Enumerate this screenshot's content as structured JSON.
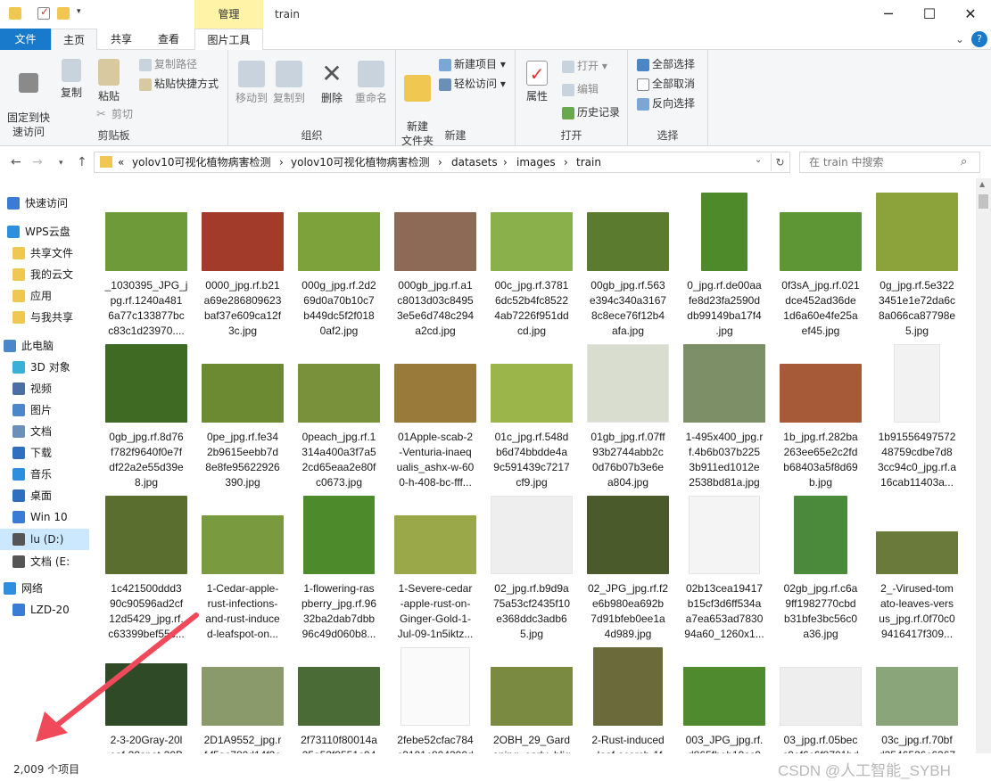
{
  "titlebar": {
    "manage_tab": "管理",
    "window_title": "train",
    "minimize": "─",
    "maximize": "☐",
    "close": "✕"
  },
  "tabs": {
    "file": "文件",
    "home": "主页",
    "share": "共享",
    "view": "查看",
    "picture_tools": "图片工具",
    "collapse": "⌄",
    "help": "?"
  },
  "ribbon": {
    "clipboard": {
      "label": "剪贴板",
      "pin": "固定到快\n速访问",
      "copy": "复制",
      "paste": "粘贴",
      "copy_path": "复制路径",
      "paste_shortcut": "粘贴快捷方式",
      "cut": "剪切"
    },
    "organize": {
      "label": "组织",
      "move_to": "移动到",
      "copy_to": "复制到",
      "delete": "删除",
      "rename": "重命名"
    },
    "new": {
      "label": "新建",
      "new_folder": "新建\n文件夹",
      "new_item": "新建项目 ▾",
      "easy_access": "轻松访问 ▾"
    },
    "open": {
      "label": "打开",
      "properties": "属性",
      "open": "打开 ▾",
      "edit": "编辑",
      "history": "历史记录"
    },
    "select": {
      "label": "选择",
      "select_all": "全部选择",
      "select_none": "全部取消",
      "invert": "反向选择"
    }
  },
  "address": {
    "crumbs": [
      "«",
      "yolov10可视化植物病害检测",
      "›",
      "yolov10可视化植物病害检测",
      "›",
      "datasets",
      "›",
      "images",
      "›",
      "train"
    ],
    "search_placeholder": "在 train 中搜索"
  },
  "navpane": {
    "items": [
      "快速访问",
      "WPS云盘",
      "共享文件",
      "我的云文",
      "应用",
      "与我共享",
      "此电脑",
      "3D 对象",
      "视频",
      "图片",
      "文档",
      "下载",
      "音乐",
      "桌面",
      "Win 10",
      "lu (D:)",
      "文档 (E:",
      "网络",
      "LZD-20"
    ]
  },
  "files": [
    {
      "name": "_1030395_JPG_j\npg.rf.1240a481\n6a77c133877bc\nc83c1d23970....",
      "color": "#6f9a3a"
    },
    {
      "name": "0000_jpg.rf.b21\na69e286809623\nbaf37e609ca12f\n3c.jpg",
      "color": "#a33b2a"
    },
    {
      "name": "000g_jpg.rf.2d2\n69d0a70b10c7\nb449dc5f2f018\n0af2.jpg",
      "color": "#7da23c"
    },
    {
      "name": "000gb_jpg.rf.a1\nc8013d03c8495\n3e5e6d748c294\na2cd.jpg",
      "color": "#8c6a55"
    },
    {
      "name": "00c_jpg.rf.3781\n6dc52b4fc8522\n4ab7226f951dd\ncd.jpg",
      "color": "#89b04a"
    },
    {
      "name": "00gb_jpg.rf.563\ne394c340a3167\n8c8ece76f12b4\nafa.jpg",
      "color": "#5b7b2e"
    },
    {
      "name": "0_jpg.rf.de00aa\nfe8d23fa2590d\ndb99149ba17f4\n.jpg",
      "color": "#4f8a2a"
    },
    {
      "name": "0f3sA_jpg.rf.021\ndce452ad36de\n1d6a60e4fe25a\nef45.jpg",
      "color": "#5e9636"
    },
    {
      "name": "0g_jpg.rf.5e322\n3451e1e72da6c\n8a066ca87798e\n5.jpg",
      "color": "#8ba33a"
    },
    {
      "name": "0gb_jpg.rf.8d76\nf782f9640f0e7f\ndf22a2e55d39e\n8.jpg",
      "color": "#3f6a24"
    },
    {
      "name": "0pe_jpg.rf.fe34\n2b9615eebb7d\n8e8fe95622926\n390.jpg",
      "color": "#6b8a32"
    },
    {
      "name": "0peach_jpg.rf.1\n314a400a3f7a5\n2cd65eaa2e80f\nc0673.jpg",
      "color": "#78913a"
    },
    {
      "name": "01Apple-scab-2\n-Venturia-inaeq\nualis_ashx-w-60\n0-h-408-bc-fff...",
      "color": "#9a7a3a"
    },
    {
      "name": "01c_jpg.rf.548d\nb6d74bbdde4a\n9c591439c7217\ncf9.jpg",
      "color": "#9cb54a"
    },
    {
      "name": "01gb_jpg.rf.07ff\n93b2744abb2c\n0d76b07b3e6e\na804.jpg",
      "color": "#d9ddd0"
    },
    {
      "name": "1-495x400_jpg.r\nf.4b6b037b225\n3b911ed1012e\n2538bd81a.jpg",
      "color": "#7d8f66"
    },
    {
      "name": "1b_jpg.rf.282ba\n263ee65e2c2fd\nb68403a5f8d69\nb.jpg",
      "color": "#a65a38"
    },
    {
      "name": "1b91556497572\n48759cdbe7d8\n3cc94c0_jpg.rf.a\n16cab11403a...",
      "color": "#f2f2f2"
    },
    {
      "name": "1c421500ddd3\n90c90596ad2cf\n12d5429_jpg.rf.\nc63399bef55c...",
      "color": "#5a6e30"
    },
    {
      "name": "1-Cedar-apple-\nrust-infections-\nand-rust-induce\nd-leafspot-on...",
      "color": "#7a9a40"
    },
    {
      "name": "1-flowering-ras\npberry_jpg.rf.96\n32ba2dab7dbb\n96c49d060b8...",
      "color": "#4c8a2c"
    },
    {
      "name": "1-Severe-cedar\n-apple-rust-on-\nGinger-Gold-1-\nJul-09-1n5iktz...",
      "color": "#9aa84a"
    },
    {
      "name": "02_jpg.rf.b9d9a\n75a53cf2435f10\ne368ddc3adb6\n5.jpg",
      "color": "#eeeeee"
    },
    {
      "name": "02_JPG_jpg.rf.f2\ne6b980ea692b\n7d91bfeb0ee1a\n4d989.jpg",
      "color": "#4a5a2a"
    },
    {
      "name": "02b13cea19417\nb15cf3d6ff534a\na7ea653ad7830\n94a60_1260x1...",
      "color": "#f4f4f4"
    },
    {
      "name": "02gb_jpg.rf.c6a\n9ff1982770cbd\nb31bfe3bc56c0\na36.jpg",
      "color": "#4a8a3a"
    },
    {
      "name": "2_-Virused-tom\nato-leaves-vers\nus_jpg.rf.0f70c0\n9416417f309...",
      "color": "#6a7a3a"
    },
    {
      "name": "2-3-20Gray-20l\neaf-20spot-20B",
      "color": "#2f4a26"
    },
    {
      "name": "2D1A9552_jpg.r\nf.f5ac780d14f2e",
      "color": "#8a9a6a"
    },
    {
      "name": "2f73110f80014a\n25a53f9551c94",
      "color": "#4a6a36"
    },
    {
      "name": "2febe52cfac784\nc3191c804390d",
      "color": "#fafafa"
    },
    {
      "name": "2OBH_29_Gard\nening_early_blig",
      "color": "#7a8a40"
    },
    {
      "name": "2-Rust-induced\n-leaf-scorch-1f",
      "color": "#6a6a3a"
    },
    {
      "name": "003_JPG_jpg.rf.\nd865fbeb19cc9",
      "color": "#4f8a2e"
    },
    {
      "name": "03_jpg.rf.05bec\nc0ef6c6f8701bd",
      "color": "#eeeeee"
    },
    {
      "name": "03c_jpg.rf.70bf\nd3546526c6367",
      "color": "#8aa57a"
    }
  ],
  "status": {
    "count": "2,009 个项目"
  },
  "watermark": "CSDN @人工智能_SYBH"
}
